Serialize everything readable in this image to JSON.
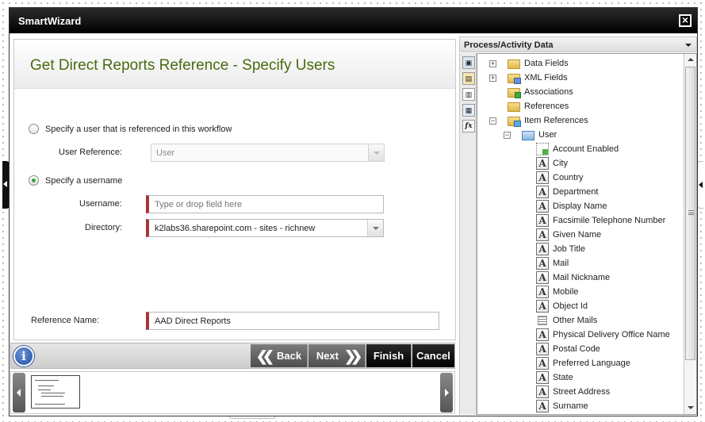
{
  "window": {
    "title": "SmartWizard"
  },
  "wizard": {
    "heading": "Get Direct Reports Reference - Specify Users",
    "option_referenced": {
      "label": "Specify a user that is referenced in this workflow",
      "selected": false
    },
    "user_reference": {
      "label": "User Reference:",
      "value": "User"
    },
    "option_username": {
      "label": "Specify a username",
      "selected": true
    },
    "username": {
      "label": "Username:",
      "placeholder": "Type or drop field here"
    },
    "directory": {
      "label": "Directory:",
      "value": "k2labs36.sharepoint.com - sites - richnew"
    },
    "reference_name": {
      "label": "Reference Name:",
      "value": "AAD Direct Reports"
    }
  },
  "nav": {
    "info": "i",
    "back": "Back",
    "next": "Next",
    "finish": "Finish",
    "cancel": "Cancel"
  },
  "data_pane": {
    "title": "Process/Activity Data",
    "tree": [
      {
        "label": "Data Fields",
        "icon": "folder-icon",
        "indent": 0,
        "expander": "+"
      },
      {
        "label": "XML Fields",
        "icon": "xml-folder-icon",
        "indent": 0,
        "expander": "+"
      },
      {
        "label": "Associations",
        "icon": "associations-folder-icon",
        "indent": 0,
        "expander": ""
      },
      {
        "label": "References",
        "icon": "references-folder-icon",
        "indent": 0,
        "expander": ""
      },
      {
        "label": "Item References",
        "icon": "item-references-folder-icon",
        "indent": 0,
        "expander": "−"
      },
      {
        "label": "User",
        "icon": "user-object-icon",
        "indent": 1,
        "expander": "−"
      },
      {
        "label": "Account Enabled",
        "icon": "boolean-field-icon",
        "indent": 2,
        "expander": ""
      },
      {
        "label": "City",
        "icon": "text-field-icon",
        "indent": 2,
        "expander": ""
      },
      {
        "label": "Country",
        "icon": "text-field-icon",
        "indent": 2,
        "expander": ""
      },
      {
        "label": "Department",
        "icon": "text-field-icon",
        "indent": 2,
        "expander": ""
      },
      {
        "label": "Display Name",
        "icon": "text-field-icon",
        "indent": 2,
        "expander": ""
      },
      {
        "label": "Facsimile Telephone Number",
        "icon": "text-field-icon",
        "indent": 2,
        "expander": ""
      },
      {
        "label": "Given Name",
        "icon": "text-field-icon",
        "indent": 2,
        "expander": ""
      },
      {
        "label": "Job Title",
        "icon": "text-field-icon",
        "indent": 2,
        "expander": ""
      },
      {
        "label": "Mail",
        "icon": "text-field-icon",
        "indent": 2,
        "expander": ""
      },
      {
        "label": "Mail Nickname",
        "icon": "text-field-icon",
        "indent": 2,
        "expander": ""
      },
      {
        "label": "Mobile",
        "icon": "text-field-icon",
        "indent": 2,
        "expander": ""
      },
      {
        "label": "Object Id",
        "icon": "text-field-icon",
        "indent": 2,
        "expander": ""
      },
      {
        "label": "Other Mails",
        "icon": "list-field-icon",
        "indent": 2,
        "expander": ""
      },
      {
        "label": "Physical Delivery Office Name",
        "icon": "text-field-icon",
        "indent": 2,
        "expander": ""
      },
      {
        "label": "Postal Code",
        "icon": "text-field-icon",
        "indent": 2,
        "expander": ""
      },
      {
        "label": "Preferred Language",
        "icon": "text-field-icon",
        "indent": 2,
        "expander": ""
      },
      {
        "label": "State",
        "icon": "text-field-icon",
        "indent": 2,
        "expander": ""
      },
      {
        "label": "Street Address",
        "icon": "text-field-icon",
        "indent": 2,
        "expander": ""
      },
      {
        "label": "Surname",
        "icon": "text-field-icon",
        "indent": 2,
        "expander": ""
      }
    ]
  }
}
